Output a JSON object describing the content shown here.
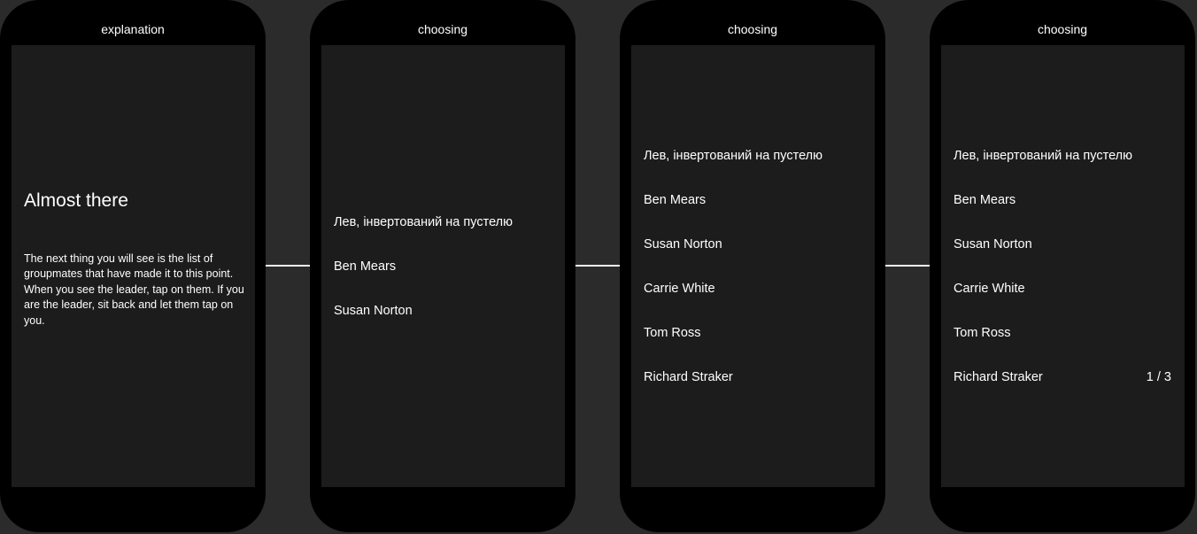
{
  "screens": [
    {
      "title": "explanation",
      "heading": "Almost there",
      "body": "The next thing you will see is the list of groupmates that have made it to this point. When you see the leader, tap on them. If you are the leader, sit back and let them tap on you."
    },
    {
      "title": "choosing",
      "items": [
        "Лев, інвертований на пустелю",
        "Ben Mears",
        "Susan Norton"
      ]
    },
    {
      "title": "choosing",
      "items": [
        "Лев, інвертований на пустелю",
        "Ben Mears",
        "Susan Norton",
        "Carrie White",
        "Tom Ross",
        "Richard Straker"
      ]
    },
    {
      "title": "choosing",
      "items": [
        "Лев, інвертований на пустелю",
        "Ben Mears",
        "Susan Norton",
        "Carrie White",
        "Tom Ross",
        "Richard Straker"
      ],
      "counter": "1 / 3"
    }
  ]
}
